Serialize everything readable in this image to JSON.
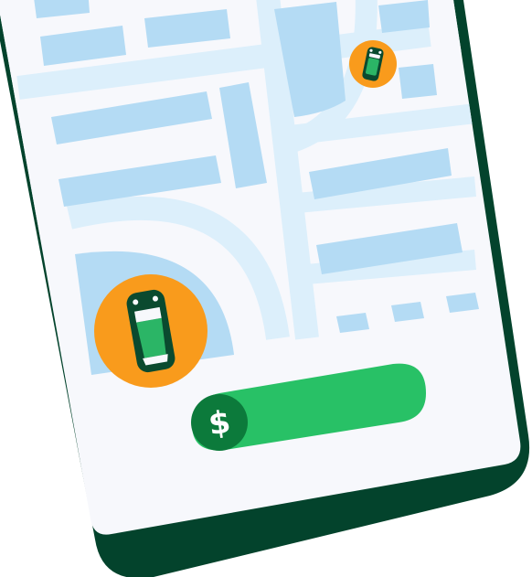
{
  "pay_slider": {
    "currency_symbol": "$"
  },
  "colors": {
    "phone_frame": "#03432C",
    "screen_bg": "#F7F8FC",
    "map_road": "#DCEFFB",
    "map_block": "#B4DBF4",
    "car_badge": "#F99B1C",
    "car_body": "#0A4A2F",
    "car_window": "#2BB566",
    "pay_track": "#28C166",
    "pay_knob": "#0C7A3B"
  },
  "icons": {
    "small_car": "car-top-view-icon",
    "large_car": "car-top-view-icon",
    "pay_button": "dollar-icon"
  }
}
